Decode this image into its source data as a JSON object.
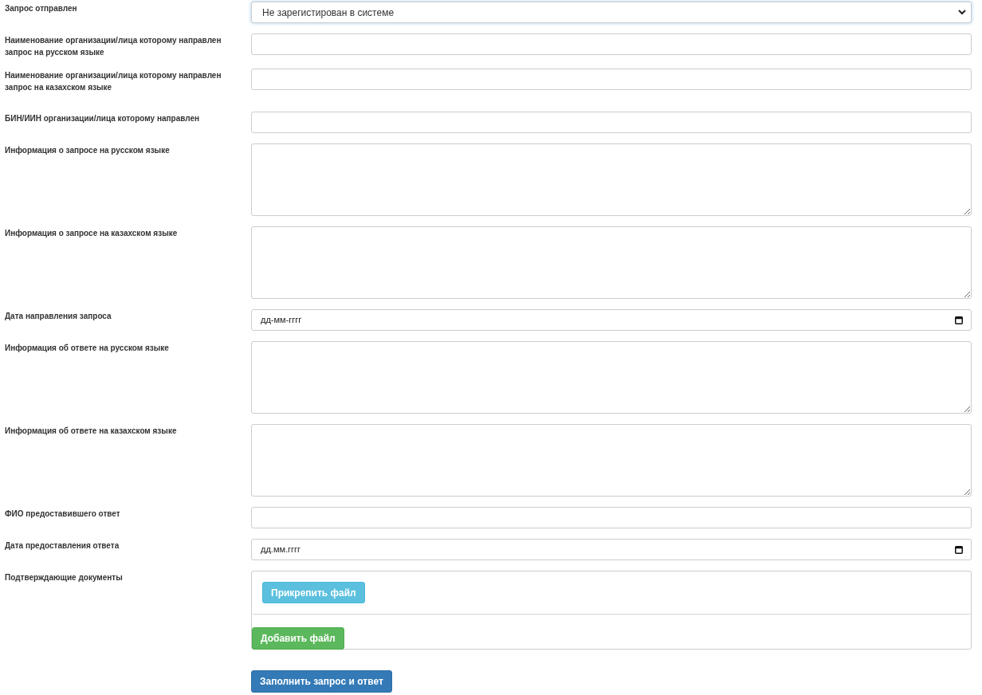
{
  "fields": [
    {
      "kind": "select",
      "label": "Запрос отправлен",
      "value": "Не зарегистирован в системе",
      "focused": true
    },
    {
      "kind": "input",
      "label": "Наименование организации/лица которому направлен запрос на русском языке"
    },
    {
      "kind": "input",
      "label": "Наименование организации/лица которому направлен запрос на казахском языке"
    },
    {
      "kind": "input",
      "label": "БИН/ИИН организации/лица которому направлен"
    },
    {
      "kind": "textarea",
      "label": "Информация о запросе на русском языке"
    },
    {
      "kind": "textarea",
      "label": "Информация о запросе на казахском языке"
    },
    {
      "kind": "date",
      "label": "Дата направления запроса",
      "placeholder": "дд-мм-гггг"
    },
    {
      "kind": "textarea",
      "label": "Информация об ответе на русском языке"
    },
    {
      "kind": "textarea",
      "label": "Информация об ответе на казахском языке"
    },
    {
      "kind": "input",
      "label": "ФИО предоставившего ответ"
    },
    {
      "kind": "date",
      "label": "Дата предоставления ответа",
      "placeholder": "дд.мм.гггг"
    },
    {
      "kind": "files",
      "label": "Подтверждающие документы",
      "attach_button": "Прикрепить файл",
      "add_button": "Добавить файл"
    }
  ],
  "submit_button": "Заполнить запрос и ответ"
}
